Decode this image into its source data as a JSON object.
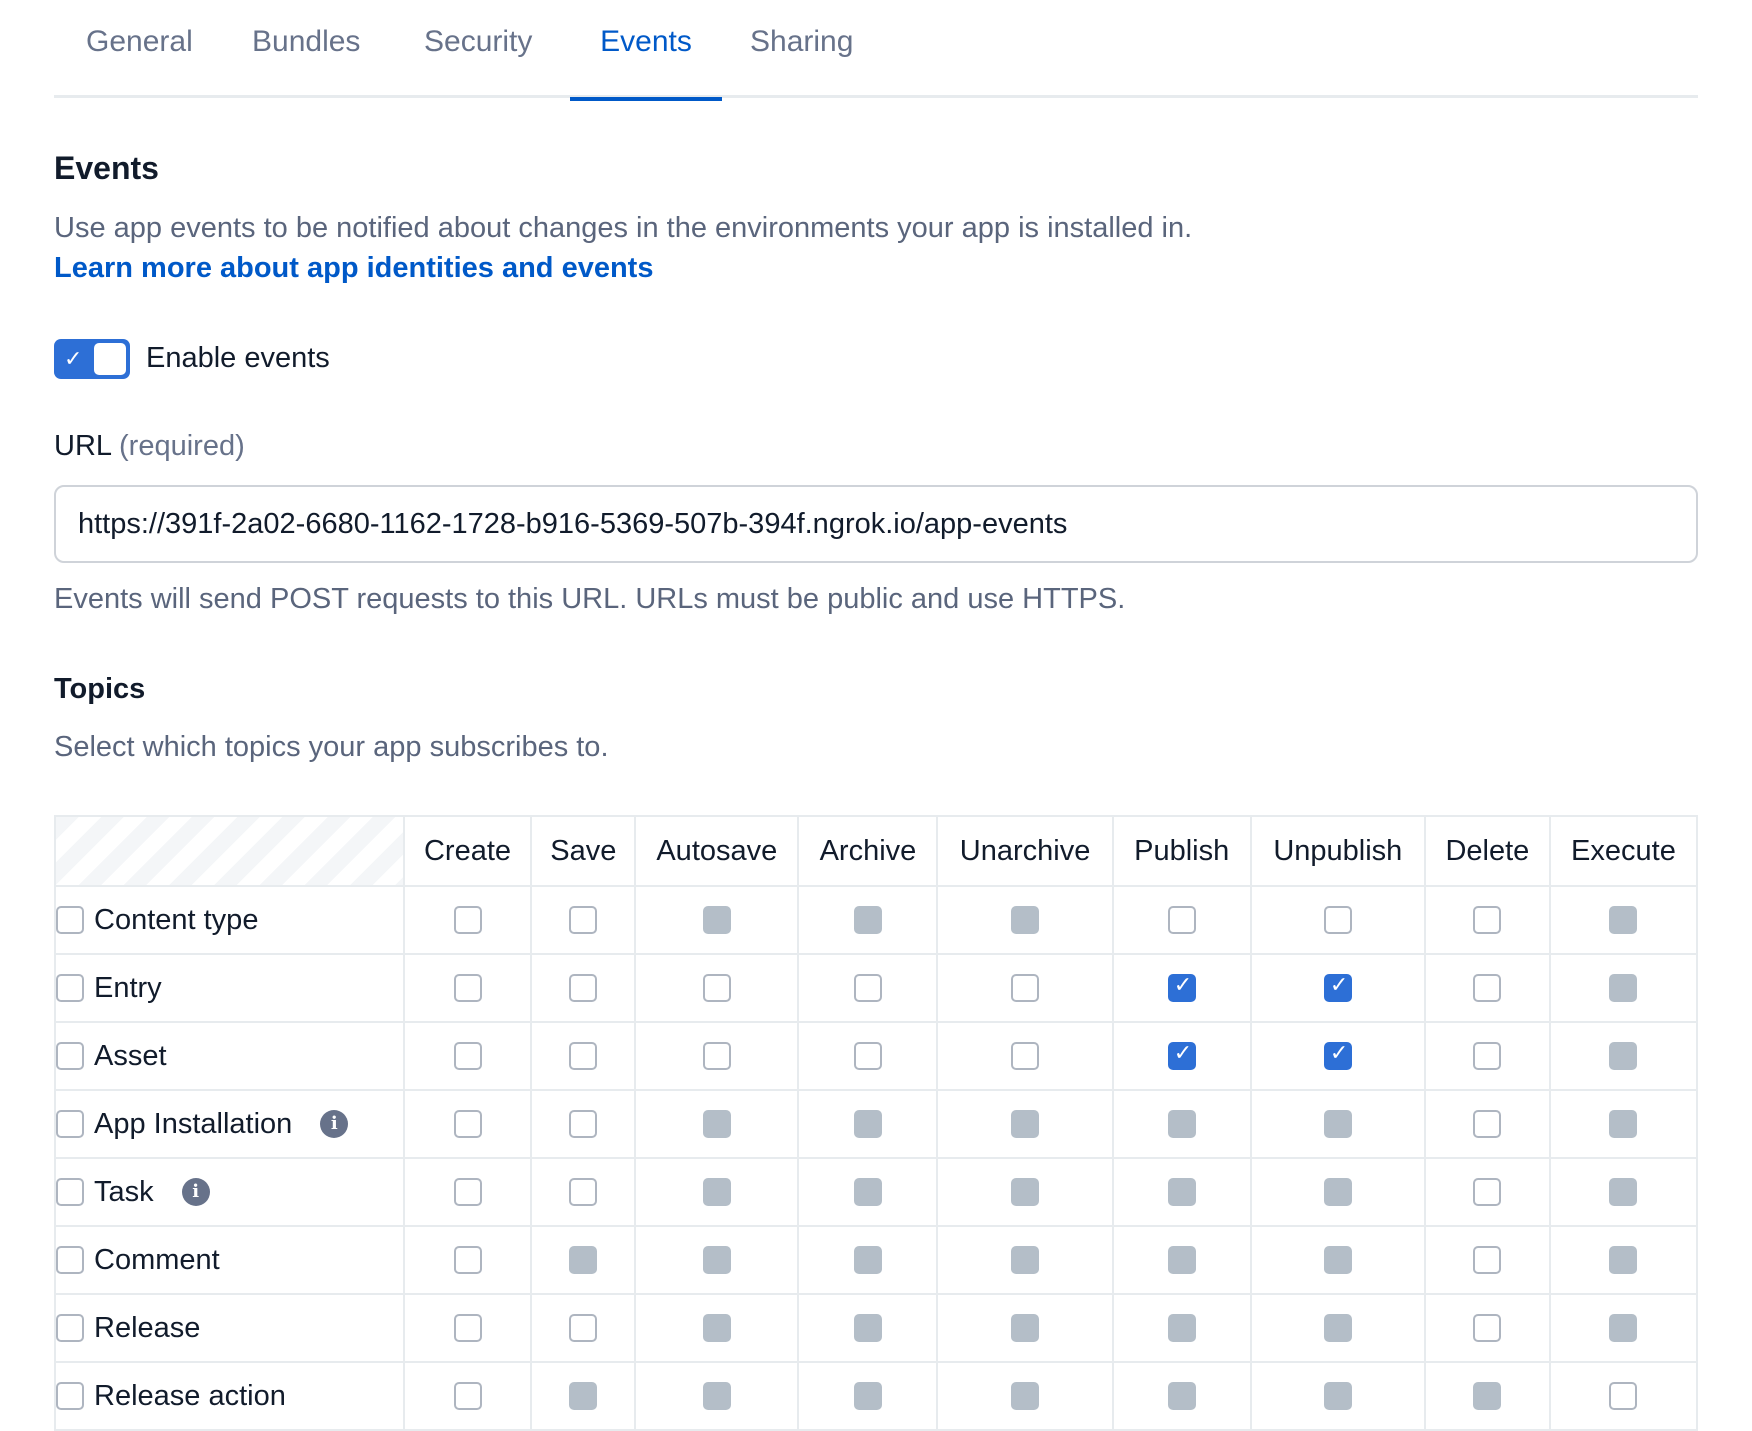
{
  "tabs": [
    {
      "label": "General"
    },
    {
      "label": "Bundles"
    },
    {
      "label": "Security"
    },
    {
      "label": "Events",
      "active": true
    },
    {
      "label": "Sharing"
    }
  ],
  "events": {
    "title": "Events",
    "description": "Use app events to be notified about changes in the environments your app is installed in.",
    "learn_more": "Learn more about app identities and events",
    "toggle_label": "Enable events",
    "toggle_on": true,
    "url_label": "URL",
    "url_required": "(required)",
    "url_value": "https://391f-2a02-6680-1162-1728-b916-5369-507b-394f.ngrok.io/app-events",
    "url_help": "Events will send POST requests to this URL. URLs must be public and use HTTPS.",
    "topics_title": "Topics",
    "topics_description": "Select which topics your app subscribes to."
  },
  "colors": {
    "accent": "#0059c8",
    "checkbox_checked": "#2d6fd6",
    "checkbox_disabled": "#b4bec8"
  },
  "topics_table": {
    "columns": [
      "Create",
      "Save",
      "Autosave",
      "Archive",
      "Unarchive",
      "Publish",
      "Unpublish",
      "Delete",
      "Execute"
    ],
    "rows": [
      {
        "label": "Content type",
        "info": false,
        "cells": [
          "off",
          "off",
          "disabled",
          "disabled",
          "disabled",
          "off",
          "off",
          "off",
          "disabled"
        ]
      },
      {
        "label": "Entry",
        "info": false,
        "cells": [
          "off",
          "off",
          "off",
          "off",
          "off",
          "on",
          "on",
          "off",
          "disabled"
        ]
      },
      {
        "label": "Asset",
        "info": false,
        "cells": [
          "off",
          "off",
          "off",
          "off",
          "off",
          "on",
          "on",
          "off",
          "disabled"
        ]
      },
      {
        "label": "App Installation",
        "info": true,
        "cells": [
          "off",
          "off",
          "disabled",
          "disabled",
          "disabled",
          "disabled",
          "disabled",
          "off",
          "disabled"
        ]
      },
      {
        "label": "Task",
        "info": true,
        "cells": [
          "off",
          "off",
          "disabled",
          "disabled",
          "disabled",
          "disabled",
          "disabled",
          "off",
          "disabled"
        ]
      },
      {
        "label": "Comment",
        "info": false,
        "cells": [
          "off",
          "disabled",
          "disabled",
          "disabled",
          "disabled",
          "disabled",
          "disabled",
          "off",
          "disabled"
        ]
      },
      {
        "label": "Release",
        "info": false,
        "cells": [
          "off",
          "off",
          "disabled",
          "disabled",
          "disabled",
          "disabled",
          "disabled",
          "off",
          "disabled"
        ]
      },
      {
        "label": "Release action",
        "info": false,
        "cells": [
          "off",
          "disabled",
          "disabled",
          "disabled",
          "disabled",
          "disabled",
          "disabled",
          "disabled",
          "off"
        ]
      }
    ]
  }
}
